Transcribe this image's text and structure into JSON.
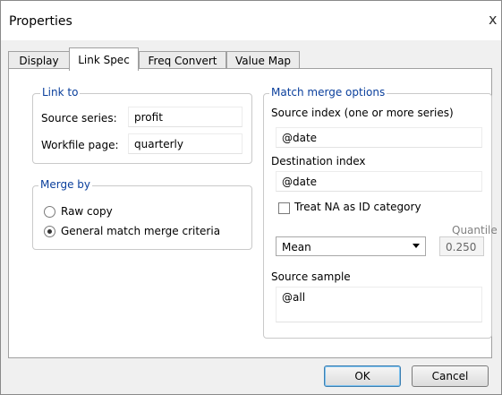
{
  "window": {
    "title": "Properties",
    "close_glyph": "x"
  },
  "tabs": [
    {
      "label": "Display",
      "active": false
    },
    {
      "label": "Link Spec",
      "active": true
    },
    {
      "label": "Freq Convert",
      "active": false
    },
    {
      "label": "Value Map",
      "active": false
    }
  ],
  "link_to": {
    "legend": "Link to",
    "source_series_label": "Source series:",
    "source_series_value": "profit",
    "workfile_page_label": "Workfile page:",
    "workfile_page_value": "quarterly"
  },
  "merge_by": {
    "legend": "Merge by",
    "options": [
      {
        "label": "Raw copy",
        "selected": false
      },
      {
        "label": "General match merge criteria",
        "selected": true
      }
    ]
  },
  "match_merge": {
    "legend": "Match merge options",
    "source_index_label": "Source index (one or more series)",
    "source_index_value": "@date",
    "destination_index_label": "Destination index",
    "destination_index_value": "@date",
    "treat_na_label": "Treat NA as ID category",
    "treat_na_checked": false,
    "method_value": "Mean",
    "quantile_label": "Quantile",
    "quantile_value": "0.250",
    "source_sample_label": "Source sample",
    "source_sample_value": "@all"
  },
  "buttons": {
    "ok": "OK",
    "cancel": "Cancel"
  },
  "icons": {
    "close": "close-icon",
    "dropdown": "chevron-down-icon"
  },
  "colors": {
    "legend_text": "#0a3f9c",
    "default_button_border": "#3c7fb1"
  }
}
